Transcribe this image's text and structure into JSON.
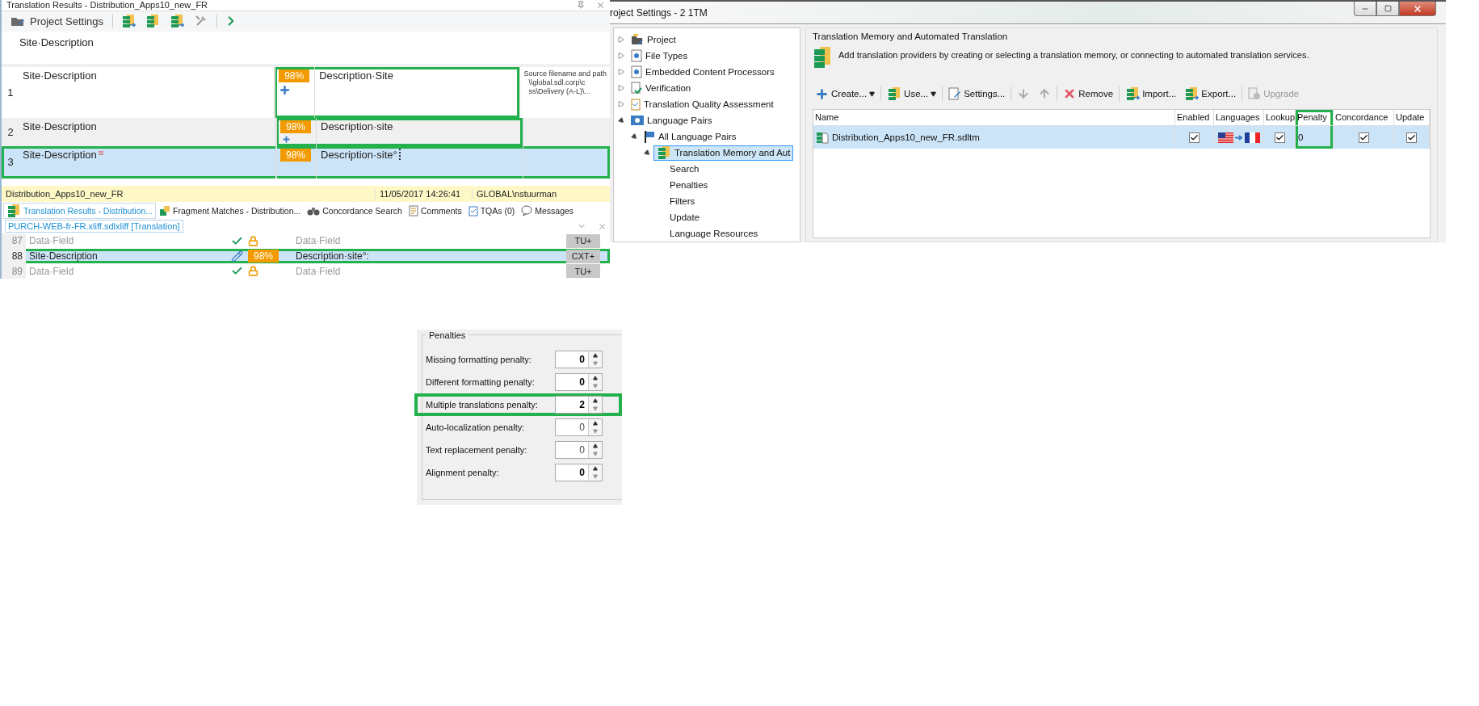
{
  "translation_results": {
    "title": "Translation Results - Distribution_Apps10_new_FR",
    "toolbar": {
      "project_settings": "Project Settings"
    },
    "source_text": "Site·Description",
    "results": [
      {
        "number": "1",
        "source": "Site·Description",
        "match": "98%",
        "target": "Description·Site",
        "plus": true,
        "deletion_mark": false,
        "cursor": false,
        "selected": false,
        "highlighted": true,
        "info": [
          "Source filename and path",
          "\\\\global.sdl.corp\\c",
          "ss\\Delivery (A-L)\\..."
        ]
      },
      {
        "number": "2",
        "source": "Site·Description",
        "match": "98%",
        "target": "Description·site",
        "plus": true,
        "deletion_mark": false,
        "cursor": false,
        "selected": false,
        "highlighted": true
      },
      {
        "number": "3",
        "source": "Site·Description",
        "match": "98%",
        "target": "Description·site°",
        "plus": false,
        "deletion_mark": true,
        "cursor": true,
        "selected": true,
        "highlighted": true
      }
    ],
    "status": {
      "memory": "Distribution_Apps10_new_FR",
      "date": "11/05/2017 14:26:41",
      "user": "GLOBAL\\nstuurman"
    },
    "tabs": [
      {
        "label": "Translation Results - Distribution...",
        "kind": "results",
        "selected": true
      },
      {
        "label": "Fragment Matches - Distribution...",
        "kind": "fragments",
        "selected": false
      },
      {
        "label": "Concordance Search",
        "kind": "concordance",
        "selected": false
      },
      {
        "label": "Comments",
        "kind": "comments",
        "selected": false
      },
      {
        "label": "TQAs (0)",
        "kind": "tqa",
        "selected": false
      },
      {
        "label": "Messages",
        "kind": "messages",
        "selected": false
      }
    ],
    "file_tab": "PURCH-WEB-fr-FR.xliff.sdlxliff [Translation]",
    "segments": [
      {
        "number": "87",
        "source": "Data·Field",
        "kind": "confirmed",
        "locked": true,
        "target": "Data·Field",
        "origin": "TU+",
        "selected": false,
        "highlighted": false
      },
      {
        "number": "88",
        "source": "Site·Description",
        "kind": "draft",
        "locked": false,
        "match": "98%",
        "target": "Description·site°:",
        "origin": "CXT+",
        "selected": true,
        "highlighted": true
      },
      {
        "number": "89",
        "source": "Data·Field",
        "kind": "confirmed",
        "locked": true,
        "target": "Data·Field",
        "origin": "TU+",
        "selected": false,
        "highlighted": false
      }
    ]
  },
  "project_settings": {
    "title": "roject Settings - 2 1TM",
    "tree": [
      {
        "label": "Project",
        "kind": "project",
        "expanded": false,
        "selected": false
      },
      {
        "label": "File Types",
        "kind": "gear",
        "expanded": false,
        "selected": false
      },
      {
        "label": "Embedded Content Processors",
        "kind": "gear",
        "expanded": false,
        "selected": false
      },
      {
        "label": "Verification",
        "kind": "verify",
        "expanded": false,
        "selected": false
      },
      {
        "label": "Translation Quality Assessment",
        "kind": "tqa",
        "expanded": false,
        "selected": false
      },
      {
        "label": "Language Pairs",
        "kind": "language",
        "expanded": true,
        "selected": false,
        "children": [
          {
            "label": "All Language Pairs",
            "kind": "flag",
            "expanded": true,
            "selected": false,
            "children": [
              {
                "label": "Translation Memory and Aut",
                "kind": "tm",
                "expanded": true,
                "selected": true,
                "children": [
                  {
                    "label": "Search",
                    "selected": false
                  },
                  {
                    "label": "Penalties",
                    "selected": false
                  },
                  {
                    "label": "Filters",
                    "selected": false
                  },
                  {
                    "label": "Update",
                    "selected": false
                  },
                  {
                    "label": "Language Resources",
                    "selected": false
                  }
                ]
              }
            ]
          }
        ]
      }
    ],
    "section_title": "Translation Memory and Automated Translation",
    "description": "Add translation providers by creating or selecting a translation memory, or connecting to automated translation services.",
    "toolbar": [
      [
        {
          "kind": "create",
          "label": "Create...",
          "dropdown": true,
          "disabled": false
        }
      ],
      [
        {
          "kind": "use",
          "label": "Use...",
          "dropdown": true,
          "disabled": false
        }
      ],
      [
        {
          "kind": "settings",
          "label": "Settings...",
          "dropdown": false,
          "disabled": false
        }
      ],
      [
        {
          "kind": "down",
          "dropdown": false,
          "disabled": true
        },
        {
          "kind": "up",
          "dropdown": false,
          "disabled": true
        }
      ],
      [
        {
          "kind": "remove",
          "label": "Remove",
          "dropdown": false,
          "disabled": false
        }
      ],
      [
        {
          "kind": "import",
          "label": "Import...",
          "dropdown": false,
          "disabled": false
        },
        {
          "kind": "export",
          "label": "Export...",
          "dropdown": false,
          "disabled": false
        }
      ],
      [
        {
          "kind": "upgrade",
          "label": "Upgrade",
          "dropdown": false,
          "disabled": true
        }
      ]
    ],
    "columns": [
      {
        "label": "Name",
        "highlighted": false
      },
      {
        "label": "Enabled",
        "highlighted": false
      },
      {
        "label": "Languages",
        "highlighted": false
      },
      {
        "label": "Lookup",
        "highlighted": false
      },
      {
        "label": "Penalty",
        "highlighted": true
      },
      {
        "label": "Concordance",
        "highlighted": false
      },
      {
        "label": "Update",
        "highlighted": false
      }
    ],
    "rows": [
      {
        "name": "Distribution_Apps10_new_FR.sdltm",
        "enabled": true,
        "lookup": true,
        "penalty": "0",
        "concordance": true,
        "update": true,
        "selected": true
      }
    ]
  },
  "penalties": {
    "title": "Penalties",
    "rows": [
      {
        "label": "Missing formatting penalty:",
        "value": "0",
        "modified": true,
        "highlighted": false
      },
      {
        "label": "Different formatting penalty:",
        "value": "0",
        "modified": true,
        "highlighted": false
      },
      {
        "label": "Multiple translations penalty:",
        "value": "2",
        "modified": true,
        "highlighted": true
      },
      {
        "label": "Auto-localization penalty:",
        "value": "0",
        "modified": false,
        "highlighted": false
      },
      {
        "label": "Text replacement penalty:",
        "value": "0",
        "modified": false,
        "highlighted": false
      },
      {
        "label": "Alignment penalty:",
        "value": "0",
        "modified": true,
        "highlighted": false
      }
    ]
  }
}
